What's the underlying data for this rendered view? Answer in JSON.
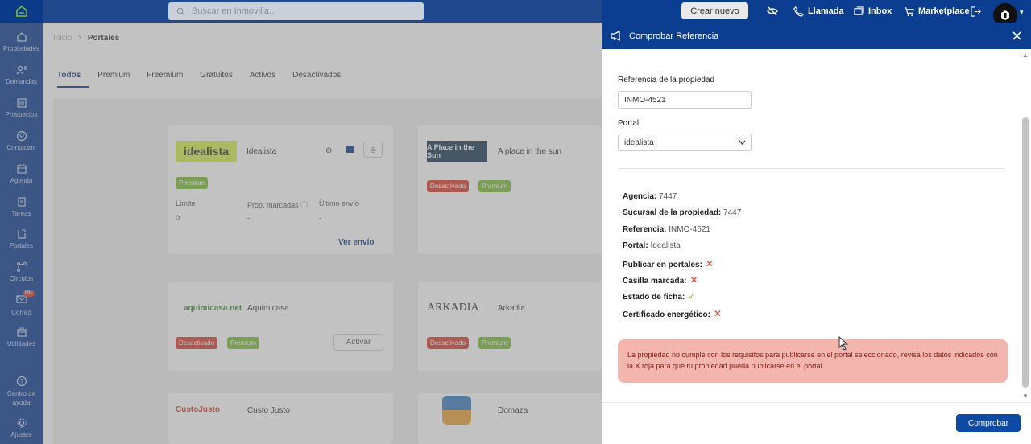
{
  "topbar": {
    "search_placeholder": "Buscar en Inmovilla...",
    "create_label": "Crear nuevo",
    "call_label": "Llamada",
    "inbox_label": "Inbox",
    "marketplace_label": "Marketplace"
  },
  "sidebar": {
    "items": [
      {
        "label": "Propiedades",
        "icon": "home-icon"
      },
      {
        "label": "Demandas",
        "icon": "person-search-icon"
      },
      {
        "label": "Prospectos",
        "icon": "list-icon"
      },
      {
        "label": "Contactos",
        "icon": "contact-icon"
      },
      {
        "label": "Agenda",
        "icon": "calendar-icon"
      },
      {
        "label": "Tareas",
        "icon": "clipboard-icon"
      },
      {
        "label": "Portales",
        "icon": "portal-icon"
      },
      {
        "label": "Círculos",
        "icon": "share-icon"
      },
      {
        "label": "Correo",
        "icon": "mail-icon"
      },
      {
        "label": "Utilidades",
        "icon": "toolbox-icon"
      },
      {
        "label": "Centro de ayuda",
        "icon": "help-icon"
      },
      {
        "label": "Ajustes",
        "icon": "gear-icon"
      }
    ],
    "mail_badge": "99+"
  },
  "breadcrumb": {
    "home": "Inicio",
    "sep": ">",
    "current": "Portales"
  },
  "tabs": [
    "Todos",
    "Premium",
    "Freemium",
    "Gratuitos",
    "Activos",
    "Desactivados"
  ],
  "cards": {
    "idealista": {
      "logo": "idealista",
      "name": "Idealista",
      "badge": "Premium",
      "col1": "Límite",
      "col2": "Prop. marcadas",
      "col3": "Último envío",
      "val1": "0",
      "val2": "-",
      "val3": "-",
      "link": "Ver envío"
    },
    "aplace": {
      "logo": "A Place in the Sun",
      "name": "A place in the sun",
      "badge1": "Desactivado",
      "badge2": "Premium"
    },
    "aquimicasa": {
      "logo": "aquimicasa.net",
      "name": "Aquimicasa",
      "badge1": "Desactivado",
      "badge2": "Premium",
      "button": "Activar"
    },
    "arkadia": {
      "logo": "ARKADIA",
      "name": "Arkadia",
      "badge1": "Desactivado",
      "badge2": "Premium"
    },
    "custojusto": {
      "logo": "CustoJusto",
      "name": "Custo Justo"
    },
    "domaza": {
      "name": "Domaza"
    }
  },
  "panel": {
    "title": "Comprobar Referencia",
    "ref_label": "Referencia de la propiedad",
    "ref_value": "INMO-4521",
    "portal_label": "Portal",
    "portal_value": "idealista",
    "details": [
      {
        "key": "Agencia:",
        "value": "7447"
      },
      {
        "key": "Sucursal de la propiedad:",
        "value": "7447"
      },
      {
        "key": "Referencia:",
        "value": "INMO-4521"
      },
      {
        "key": "Portal:",
        "value": "Idealista"
      }
    ],
    "checks": [
      {
        "key": "Publicar en portales:",
        "ok": false
      },
      {
        "key": "Casilla marcada:",
        "ok": false
      },
      {
        "key": "Estado de ficha:",
        "ok": true
      },
      {
        "key": "Certificado energético:",
        "ok": false
      }
    ],
    "alert": "La propiedad no cumple con los requisitos para publicarse en el portal seleccionado, revisa los datos indicados con la X roja para que tu propiedad pueda publicarse en el portal.",
    "submit_label": "Comprobar"
  },
  "colors": {
    "brand": "#0b3d91",
    "danger": "#d9412f",
    "success": "#7fbe3b",
    "alert_bg": "#f3b5ad"
  }
}
